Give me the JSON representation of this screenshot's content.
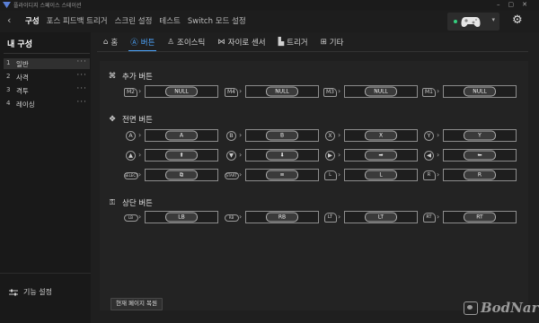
{
  "app": {
    "title": "플라이디지 스페이스 스테이션"
  },
  "nav": {
    "back": "‹",
    "items": [
      "구성",
      "포스 피드백 트리거",
      "스크린 설정",
      "테스트",
      "Switch 모드 설정"
    ]
  },
  "sidebar": {
    "title": "내 구성",
    "profiles": [
      {
        "num": "1",
        "name": "일반"
      },
      {
        "num": "2",
        "name": "사격"
      },
      {
        "num": "3",
        "name": "격투"
      },
      {
        "num": "4",
        "name": "레이싱"
      }
    ],
    "more": "···",
    "function_settings": "기능 설정"
  },
  "tabs": [
    {
      "icon": "home-icon",
      "label": "홈"
    },
    {
      "icon": "button-icon",
      "label": "버튼"
    },
    {
      "icon": "joystick-icon",
      "label": "조이스틱"
    },
    {
      "icon": "gyro-icon",
      "label": "자이로 센서"
    },
    {
      "icon": "trigger-icon",
      "label": "트리거"
    },
    {
      "icon": "misc-icon",
      "label": "기타"
    }
  ],
  "sections": {
    "extra": {
      "title": "추가 버튼",
      "buttons": [
        {
          "badge": "M2",
          "value": "NULL"
        },
        {
          "badge": "M4",
          "value": "NULL"
        },
        {
          "badge": "M3",
          "value": "NULL"
        },
        {
          "badge": "M1",
          "value": "NULL"
        }
      ]
    },
    "front": {
      "title": "전면 버튼",
      "rows": [
        [
          {
            "badge": "A",
            "value": "A"
          },
          {
            "badge": "B",
            "value": "B"
          },
          {
            "badge": "X",
            "value": "X"
          },
          {
            "badge": "Y",
            "value": "Y"
          }
        ],
        [
          {
            "badge": "▲",
            "value": "⬆"
          },
          {
            "badge": "▼",
            "value": "⬇"
          },
          {
            "badge": "▶",
            "value": "➡"
          },
          {
            "badge": "◀",
            "value": "⬅"
          }
        ],
        [
          {
            "badge": "SELECT",
            "value": "⧉"
          },
          {
            "badge": "START",
            "value": "≡"
          },
          {
            "badge": "L",
            "value": "L"
          },
          {
            "badge": "R",
            "value": "R"
          }
        ]
      ]
    },
    "top": {
      "title": "상단 버튼",
      "buttons": [
        {
          "badge": "LB",
          "value": "LB"
        },
        {
          "badge": "RB",
          "value": "RB"
        },
        {
          "badge": "LT",
          "value": "LT"
        },
        {
          "badge": "RT",
          "value": "RT"
        }
      ]
    }
  },
  "footer": {
    "restore": "현재 페이지 복원"
  },
  "watermark": "BodNara",
  "colors": {
    "accent": "#4da6ff",
    "status": "#35d07f"
  }
}
